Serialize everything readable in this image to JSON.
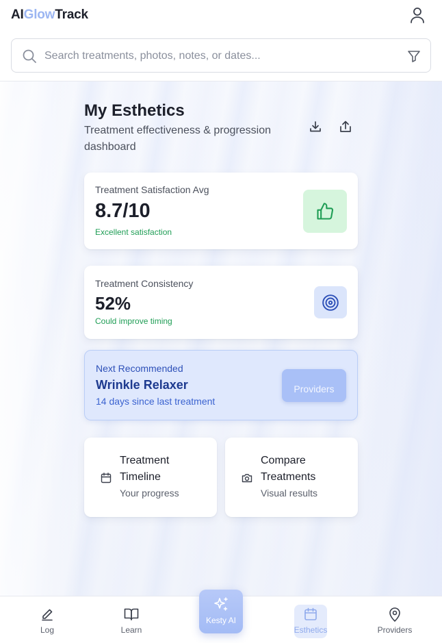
{
  "app": {
    "brand_ai": "AI",
    "brand_glow": "Glow",
    "brand_track": "Track"
  },
  "search": {
    "placeholder": "Search treatments, photos, notes, or dates...",
    "value": ""
  },
  "page": {
    "title": "My Esthetics",
    "subtitle": "Treatment effectiveness & progression dashboard"
  },
  "stats": [
    {
      "label": "Treatment Satisfaction Avg",
      "value": "8.7/10",
      "note": "Excellent satisfaction",
      "icon": "thumbs-up-icon"
    },
    {
      "label": "Treatment Consistency",
      "value": "52%",
      "note": "Could improve timing",
      "icon": "target-icon"
    }
  ],
  "recommendation": {
    "label": "Next Recommended",
    "title": "Wrinkle Relaxer",
    "note": "14 days since last treatment",
    "button": "Providers"
  },
  "tiles": [
    {
      "title": "Treatment Timeline",
      "subtitle": "Your progress",
      "icon": "calendar-icon"
    },
    {
      "title": "Compare Treatments",
      "subtitle": "Visual results",
      "icon": "camera-icon"
    }
  ],
  "nav": {
    "log": "Log",
    "learn": "Learn",
    "kesty": "Kesty AI",
    "esthetics": "Esthetics",
    "providers": "Providers",
    "active": "Esthetics"
  },
  "colors": {
    "accent": "#9cb6f2",
    "success": "#1f9d55",
    "recommend_bg": "#dfe8fd"
  }
}
